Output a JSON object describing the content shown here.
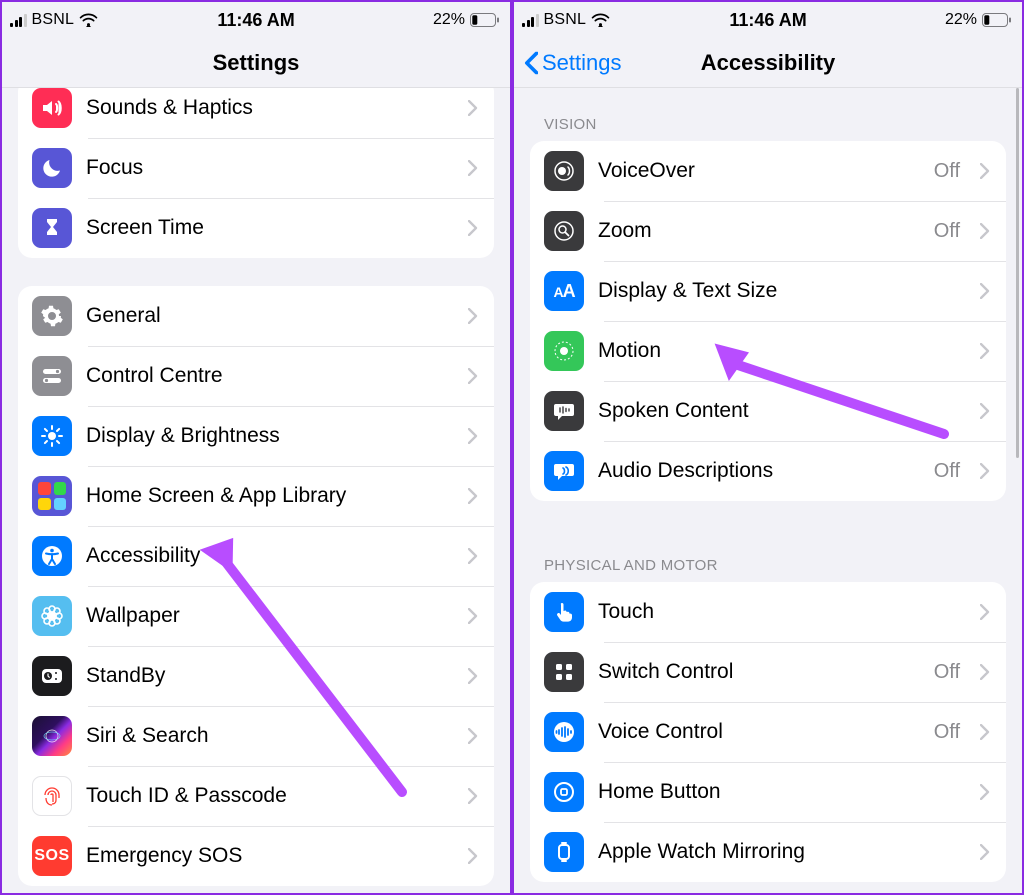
{
  "status": {
    "carrier": "BSNL",
    "time": "11:46 AM",
    "battery_pct": "22%"
  },
  "page_left": {
    "nav_title": "Settings",
    "group1": [
      {
        "id": "sounds",
        "label": "Sounds & Haptics"
      },
      {
        "id": "focus",
        "label": "Focus"
      },
      {
        "id": "screentime",
        "label": "Screen Time"
      }
    ],
    "group2": [
      {
        "id": "general",
        "label": "General"
      },
      {
        "id": "controlcentre",
        "label": "Control Centre"
      },
      {
        "id": "display",
        "label": "Display & Brightness"
      },
      {
        "id": "homescreen",
        "label": "Home Screen & App Library"
      },
      {
        "id": "accessibility",
        "label": "Accessibility"
      },
      {
        "id": "wallpaper",
        "label": "Wallpaper"
      },
      {
        "id": "standby",
        "label": "StandBy"
      },
      {
        "id": "siri",
        "label": "Siri & Search"
      },
      {
        "id": "touchid",
        "label": "Touch ID & Passcode"
      },
      {
        "id": "sos",
        "label": "Emergency SOS"
      }
    ]
  },
  "page_right": {
    "back_label": "Settings",
    "nav_title": "Accessibility",
    "section_vision": "Vision",
    "vision_rows": [
      {
        "id": "voiceover",
        "label": "VoiceOver",
        "value": "Off"
      },
      {
        "id": "zoom",
        "label": "Zoom",
        "value": "Off"
      },
      {
        "id": "textsize",
        "label": "Display & Text Size",
        "value": ""
      },
      {
        "id": "motion",
        "label": "Motion",
        "value": ""
      },
      {
        "id": "spoken",
        "label": "Spoken Content",
        "value": ""
      },
      {
        "id": "audiodesc",
        "label": "Audio Descriptions",
        "value": "Off"
      }
    ],
    "section_motor": "Physical and Motor",
    "motor_rows": [
      {
        "id": "touch",
        "label": "Touch",
        "value": ""
      },
      {
        "id": "switchctl",
        "label": "Switch Control",
        "value": "Off"
      },
      {
        "id": "voicectl",
        "label": "Voice Control",
        "value": "Off"
      },
      {
        "id": "homebtn",
        "label": "Home Button",
        "value": ""
      },
      {
        "id": "watchmirr",
        "label": "Apple Watch Mirroring",
        "value": ""
      }
    ]
  },
  "annotation_color": "#b84dff"
}
